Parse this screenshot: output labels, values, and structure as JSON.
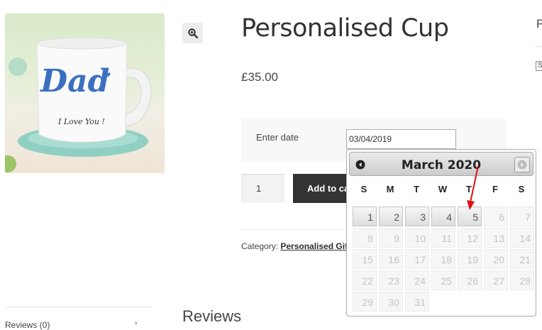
{
  "product": {
    "title": "Personalised Cup",
    "price": "£35.00",
    "mug_text_main": "Dad",
    "mug_text_sub": "I Love You !"
  },
  "date_field": {
    "label": "Enter date",
    "value": "03/04/2019"
  },
  "quantity": {
    "value": "1"
  },
  "add_to_cart": {
    "label": "Add to ca"
  },
  "meta": {
    "category_prefix": "Category:",
    "category_link": "Personalised Gifti"
  },
  "tabs": {
    "reviews_tab": "Reviews (0)",
    "reviews_heading": "Reviews"
  },
  "sidebar_right": {
    "heading_fragment": "F",
    "select_fragment": "S"
  },
  "datepicker": {
    "title": "March 2020",
    "weekdays": [
      "S",
      "M",
      "T",
      "W",
      "T",
      "F",
      "S"
    ],
    "weeks": [
      [
        {
          "d": "",
          "s": "empty"
        },
        {
          "d": "1",
          "s": "active"
        },
        {
          "d": "2",
          "s": "active"
        },
        {
          "d": "3",
          "s": "active"
        },
        {
          "d": "4",
          "s": "active"
        },
        {
          "d": "5",
          "s": "active"
        },
        {
          "d": "6",
          "s": "disabled"
        },
        {
          "d": "7",
          "s": "disabled"
        }
      ],
      [
        {
          "d": "8",
          "s": "disabled"
        },
        {
          "d": "9",
          "s": "disabled"
        },
        {
          "d": "10",
          "s": "disabled"
        },
        {
          "d": "11",
          "s": "disabled"
        },
        {
          "d": "12",
          "s": "disabled"
        },
        {
          "d": "13",
          "s": "disabled"
        },
        {
          "d": "14",
          "s": "disabled"
        }
      ],
      [
        {
          "d": "15",
          "s": "disabled"
        },
        {
          "d": "16",
          "s": "disabled"
        },
        {
          "d": "17",
          "s": "disabled"
        },
        {
          "d": "18",
          "s": "disabled"
        },
        {
          "d": "19",
          "s": "disabled"
        },
        {
          "d": "20",
          "s": "disabled"
        },
        {
          "d": "21",
          "s": "disabled"
        }
      ],
      [
        {
          "d": "22",
          "s": "disabled"
        },
        {
          "d": "23",
          "s": "disabled"
        },
        {
          "d": "24",
          "s": "disabled"
        },
        {
          "d": "25",
          "s": "disabled"
        },
        {
          "d": "26",
          "s": "disabled"
        },
        {
          "d": "27",
          "s": "disabled"
        },
        {
          "d": "28",
          "s": "disabled"
        }
      ],
      [
        {
          "d": "29",
          "s": "disabled"
        },
        {
          "d": "30",
          "s": "disabled"
        },
        {
          "d": "31",
          "s": "disabled"
        }
      ]
    ],
    "prev_icon": "circle-arrow-left-icon",
    "next_icon": "circle-arrow-right-icon"
  },
  "colors": {
    "button_dark": "#333333",
    "annotation_arrow": "#e01010",
    "mug_text_blue": "#3b6fc0"
  }
}
